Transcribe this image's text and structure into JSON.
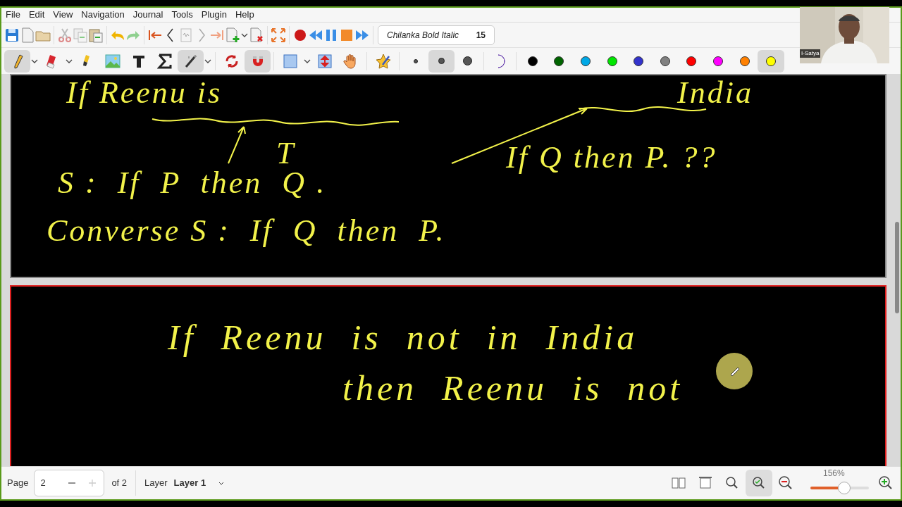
{
  "menu": [
    "File",
    "Edit",
    "View",
    "Navigation",
    "Journal",
    "Tools",
    "Plugin",
    "Help"
  ],
  "font_selector": {
    "font": "Chilanka Bold Italic",
    "size": "15"
  },
  "tools": [
    {
      "selected": true
    },
    {
      "selected": false
    },
    {
      "selected": false
    },
    {
      "selected": false
    },
    {
      "selected": false
    },
    {
      "selected": false
    },
    {
      "selected": true
    },
    {
      "selected": false
    },
    {
      "selected": true
    },
    {
      "selected": false
    },
    {
      "selected": false
    },
    {
      "selected": false
    },
    {
      "selected": false
    }
  ],
  "pen_sizes": [
    {
      "selected": false
    },
    {
      "selected": true
    },
    {
      "selected": false
    }
  ],
  "colors": [
    {
      "color": "#000000",
      "selected": false
    },
    {
      "color": "#006400",
      "selected": false
    },
    {
      "color": "#00a8e6",
      "selected": false
    },
    {
      "color": "#00e600",
      "selected": false
    },
    {
      "color": "#3333cc",
      "selected": false
    },
    {
      "color": "#808080",
      "selected": false
    },
    {
      "color": "#ff0000",
      "selected": false
    },
    {
      "color": "#ff00ff",
      "selected": false
    },
    {
      "color": "#ff8000",
      "selected": false
    },
    {
      "color": "#ffff00",
      "selected": true
    }
  ],
  "pages": [
    {
      "selected": false,
      "ink": [
        "If Reenu is",
        "India",
        "T",
        "S :  If  P  then  Q .",
        "If Q then P. ??",
        "Converse S :  If  Q  then  P."
      ]
    },
    {
      "selected": true,
      "ink": [
        "If  Reenu  is  not  in  India",
        "then  Reenu  is  not"
      ]
    }
  ],
  "webcam": {
    "label": "I-Satya"
  },
  "status_bar": {
    "page_label": "Page",
    "page": "2",
    "page_total": "of 2",
    "layer_label": "Layer",
    "layer": "Layer 1",
    "zoom": "156%",
    "zoom_level": {
      "level": 0.6
    }
  }
}
